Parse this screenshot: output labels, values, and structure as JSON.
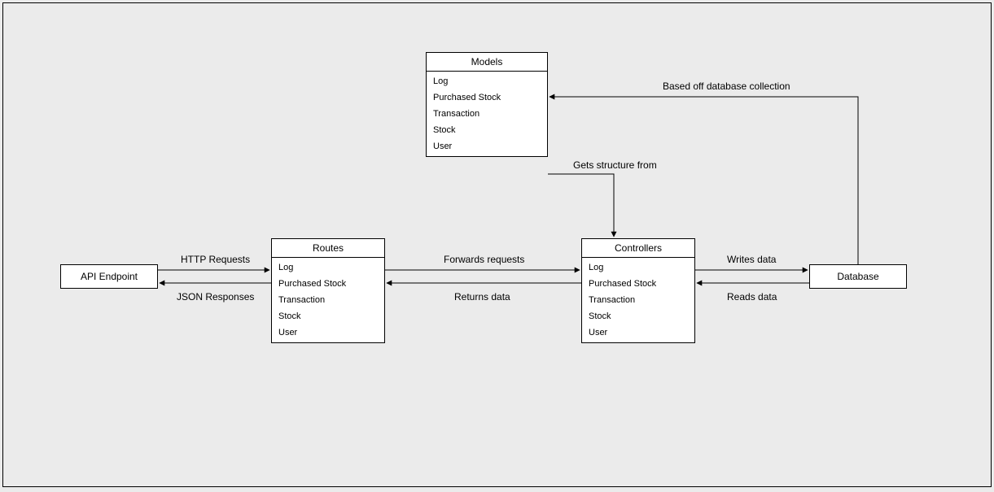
{
  "nodes": {
    "api": {
      "label": "API Endpoint"
    },
    "routes": {
      "title": "Routes",
      "items": [
        "Log",
        "Purchased Stock",
        "Transaction",
        "Stock",
        "User"
      ]
    },
    "controllers": {
      "title": "Controllers",
      "items": [
        "Log",
        "Purchased Stock",
        "Transaction",
        "Stock",
        "User"
      ]
    },
    "models": {
      "title": "Models",
      "items": [
        "Log",
        "Purchased Stock",
        "Transaction",
        "Stock",
        "User"
      ]
    },
    "database": {
      "label": "Database"
    }
  },
  "edges": {
    "http_requests": "HTTP Requests",
    "json_responses": "JSON Responses",
    "forwards_requests": "Forwards requests",
    "returns_data": "Returns data",
    "gets_structure": "Gets structure from",
    "based_off": "Based off database collection",
    "writes_data": "Writes data",
    "reads_data": "Reads data"
  }
}
